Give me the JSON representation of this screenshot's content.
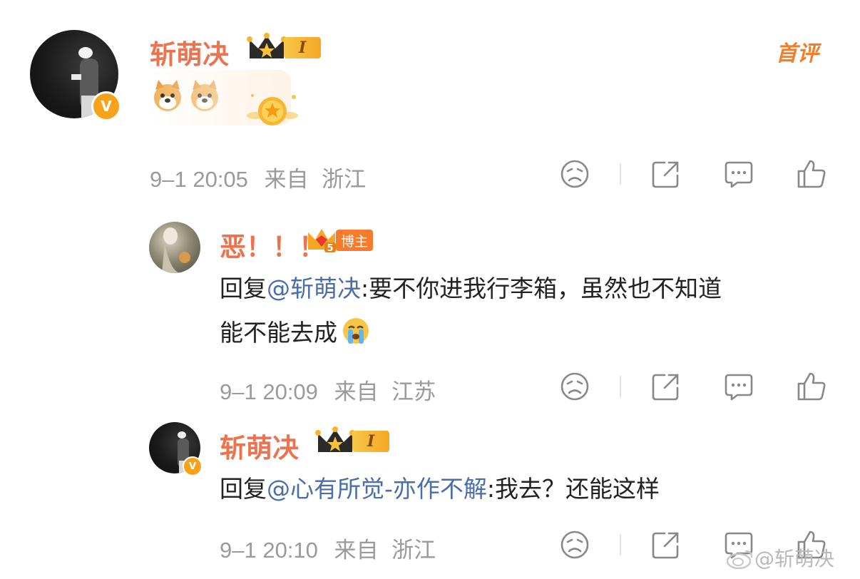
{
  "colors": {
    "name": "#eb7350",
    "mention": "#4a6ea9",
    "meta": "#9a9a9a",
    "badge": "#f7a21b"
  },
  "first_comment_label": "首评",
  "comments": [
    {
      "username": "斩萌决",
      "level_badge": "I",
      "avatar_badge": "V",
      "emoji": [
        "dog-face-emoji",
        "dog-face-emoji"
      ],
      "sticker": "star-badge-sticker",
      "time": "9–1 20:05",
      "from_label": "来自",
      "location": "浙江"
    },
    {
      "username": "恶！！！",
      "crown_level": "5",
      "role_badge": "博主",
      "reply_prefix": "回复",
      "mention": "@斩萌决",
      "text_line1": ":要不你进我行李箱，虽然也不知道",
      "text_line2": "能不能去成",
      "time": "9–1 20:09",
      "from_label": "来自",
      "location": "江苏"
    },
    {
      "username": "斩萌决",
      "level_badge": "I",
      "avatar_badge": "V",
      "reply_prefix": "回复",
      "mention": "@心有所觉-亦作不解",
      "text": ":我去？还能这样",
      "time": "9–1 20:10",
      "from_label": "来自",
      "location": "浙江"
    }
  ],
  "watermark": "@斩萌决"
}
